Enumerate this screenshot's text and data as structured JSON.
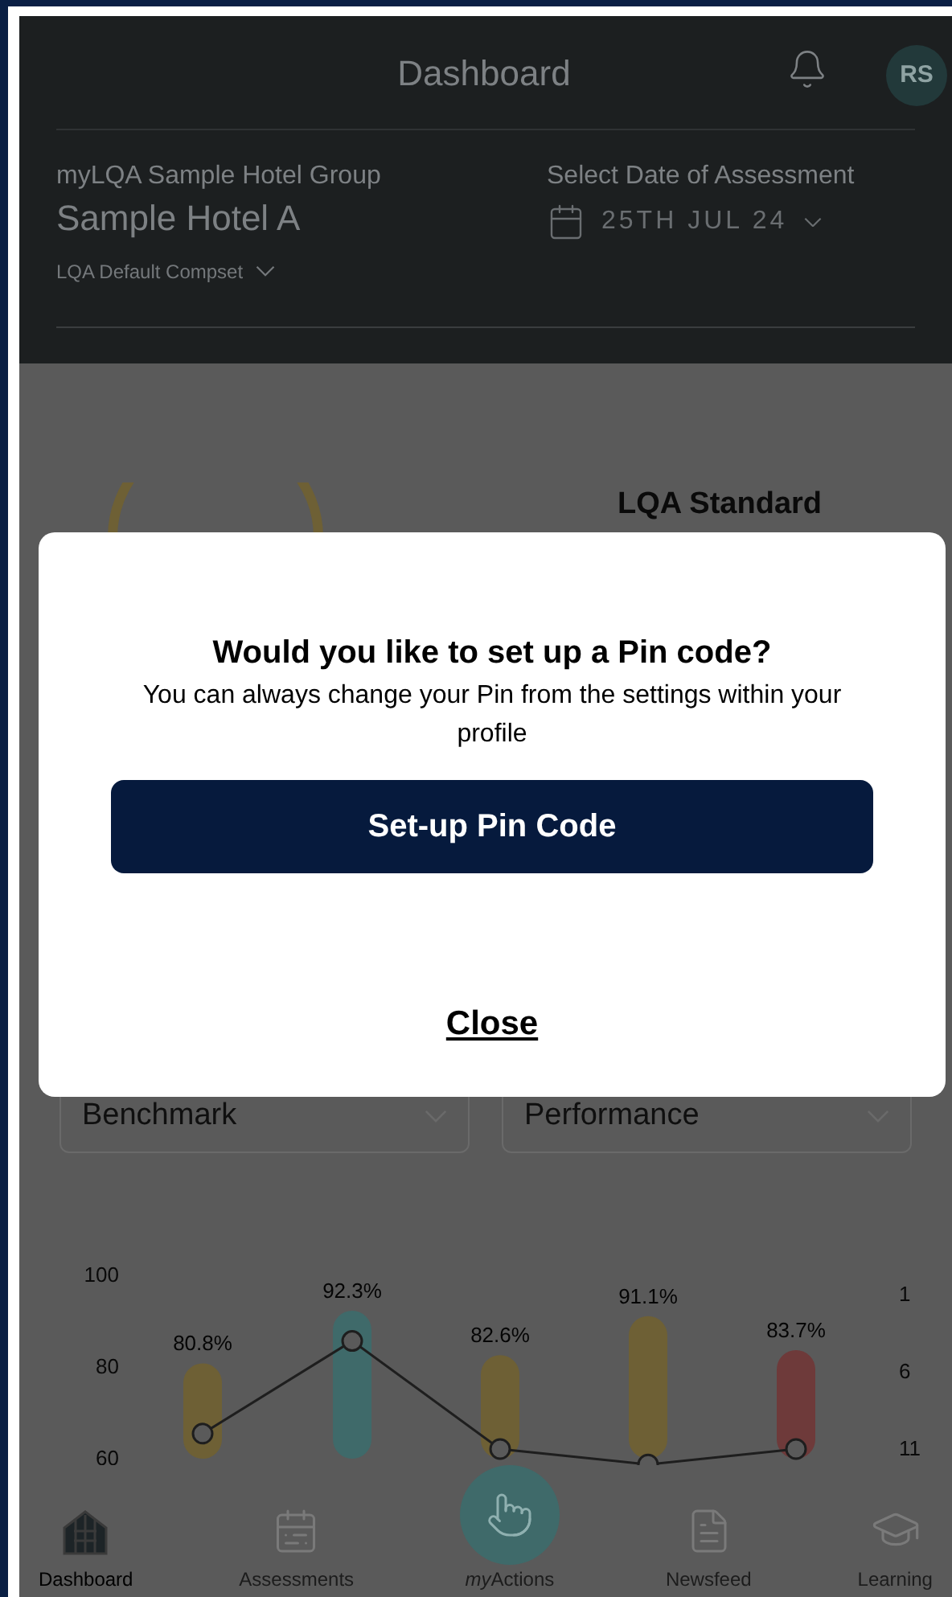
{
  "header": {
    "title": "Dashboard",
    "avatar": "RS",
    "group": "myLQA Sample Hotel Group",
    "hotel": "Sample Hotel A",
    "compset": "LQA Default Compset",
    "date_label": "Select Date of Assessment",
    "date": "25TH JUL 24"
  },
  "standard": {
    "title": "LQA Standard"
  },
  "dialog": {
    "title": "Would you like to set up a Pin code?",
    "message": "You can always change your Pin from the settings within your profile",
    "primary": "Set-up Pin Code",
    "close": "Close"
  },
  "filters": [
    {
      "label": "Benchmark"
    },
    {
      "label": "Performance"
    }
  ],
  "chart": {
    "axis_labels": [
      "100",
      "80",
      "60"
    ],
    "value_labels": [
      "80.8%",
      "92.3%",
      "82.6%",
      "91.1%",
      "83.7%"
    ]
  },
  "rank_axis": [
    "1",
    "6",
    "11"
  ],
  "nav": [
    {
      "label": "Dashboard",
      "kind": "dashboard",
      "selected": true
    },
    {
      "label": "Assessments",
      "kind": "assessments",
      "selected": false
    },
    {
      "prefix": "my",
      "label": "Actions",
      "kind": "actions",
      "selected": false
    },
    {
      "label": "Newsfeed",
      "kind": "newsfeed",
      "selected": false
    },
    {
      "label": "Learning",
      "kind": "learning",
      "selected": false
    }
  ]
}
